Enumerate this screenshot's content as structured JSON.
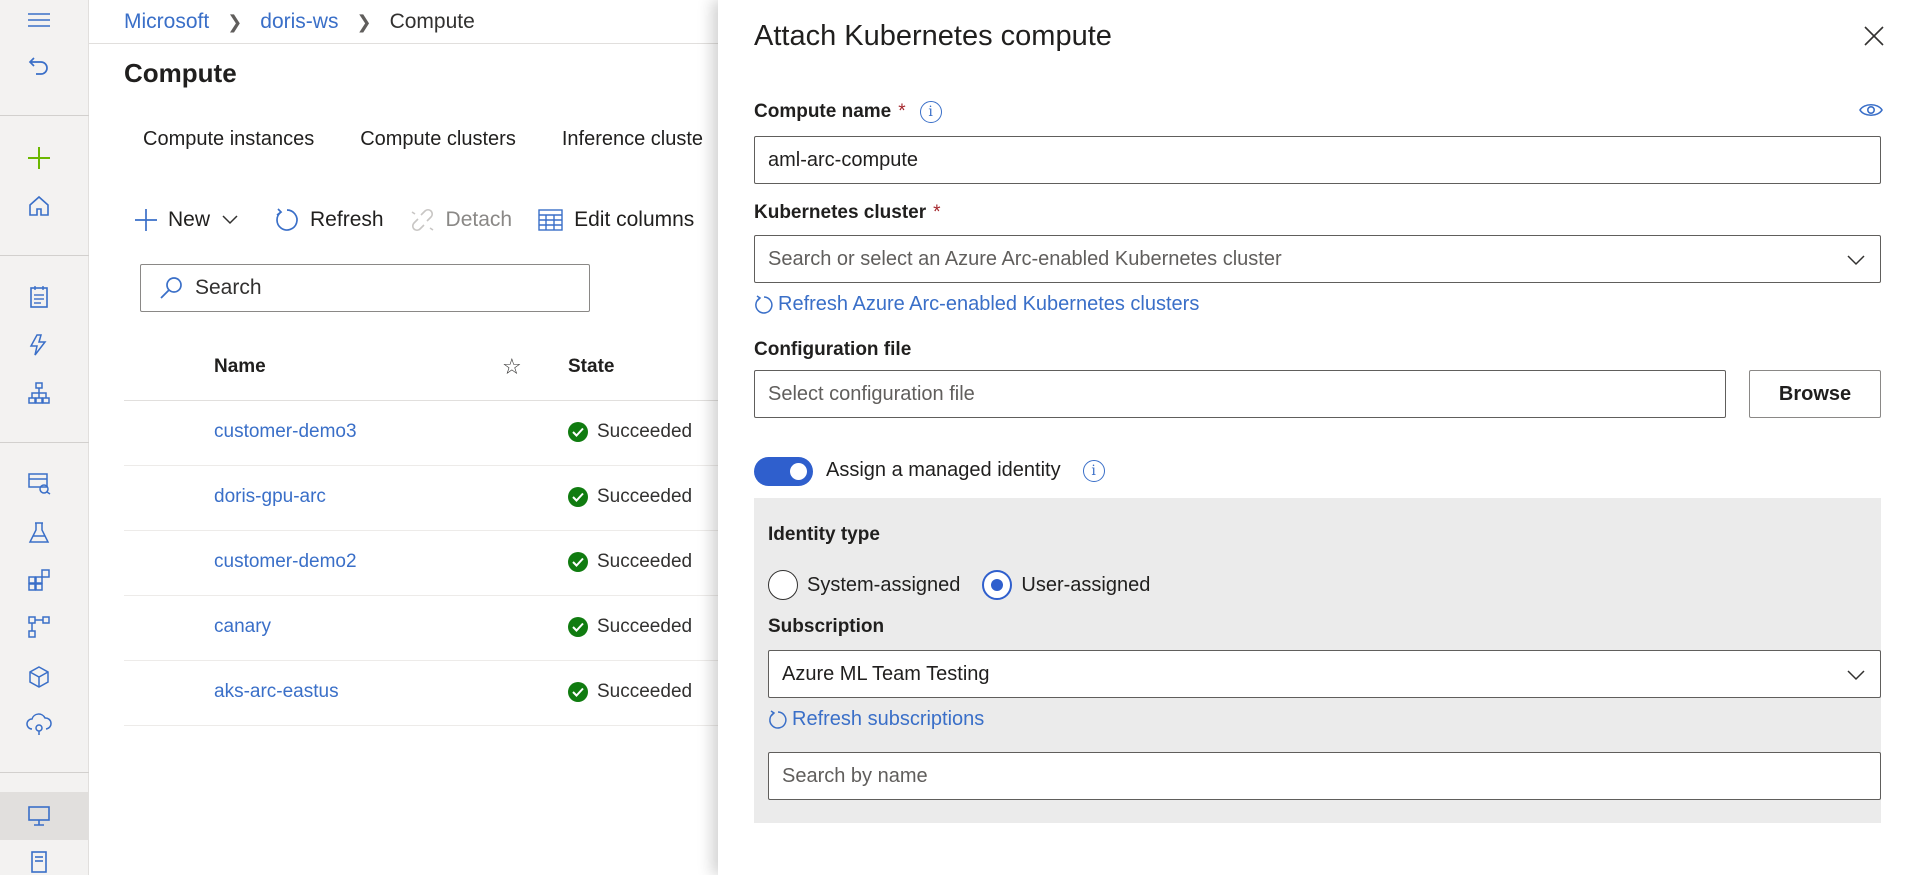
{
  "breadcrumb": {
    "root": "Microsoft",
    "workspace": "doris-ws",
    "current": "Compute"
  },
  "page": {
    "title": "Compute"
  },
  "tabs": [
    {
      "label": "Compute instances"
    },
    {
      "label": "Compute clusters"
    },
    {
      "label": "Inference cluste"
    }
  ],
  "toolbar": {
    "new_label": "New",
    "refresh_label": "Refresh",
    "detach_label": "Detach",
    "edit_columns_label": "Edit columns"
  },
  "search": {
    "placeholder": "Search"
  },
  "table": {
    "columns": {
      "name": "Name",
      "state": "State"
    },
    "rows": [
      {
        "name": "customer-demo3",
        "state": "Succeeded"
      },
      {
        "name": "doris-gpu-arc",
        "state": "Succeeded"
      },
      {
        "name": "customer-demo2",
        "state": "Succeeded"
      },
      {
        "name": "canary",
        "state": "Succeeded"
      },
      {
        "name": "aks-arc-eastus",
        "state": "Succeeded"
      }
    ]
  },
  "panel": {
    "title": "Attach Kubernetes compute",
    "compute_name": {
      "label": "Compute name",
      "required": "*",
      "value": "aml-arc-compute"
    },
    "kubernetes_cluster": {
      "label": "Kubernetes cluster",
      "required": "*",
      "placeholder": "Search or select an Azure Arc-enabled Kubernetes cluster",
      "refresh_link": "Refresh Azure Arc-enabled Kubernetes clusters"
    },
    "configuration_file": {
      "label": "Configuration file",
      "placeholder": "Select configuration file",
      "browse_label": "Browse"
    },
    "managed_identity": {
      "label": "Assign a managed identity",
      "enabled": true
    },
    "identity_type": {
      "label": "Identity type",
      "options": [
        "System-assigned",
        "User-assigned"
      ],
      "selected": "User-assigned"
    },
    "subscription": {
      "label": "Subscription",
      "value": "Azure ML Team Testing",
      "refresh_link": "Refresh subscriptions"
    },
    "search_by_name": {
      "placeholder": "Search by name"
    }
  },
  "colors": {
    "accent": "#2f5fcd",
    "link": "#3a6fc8",
    "success": "#107c10",
    "required": "#a4262c"
  }
}
